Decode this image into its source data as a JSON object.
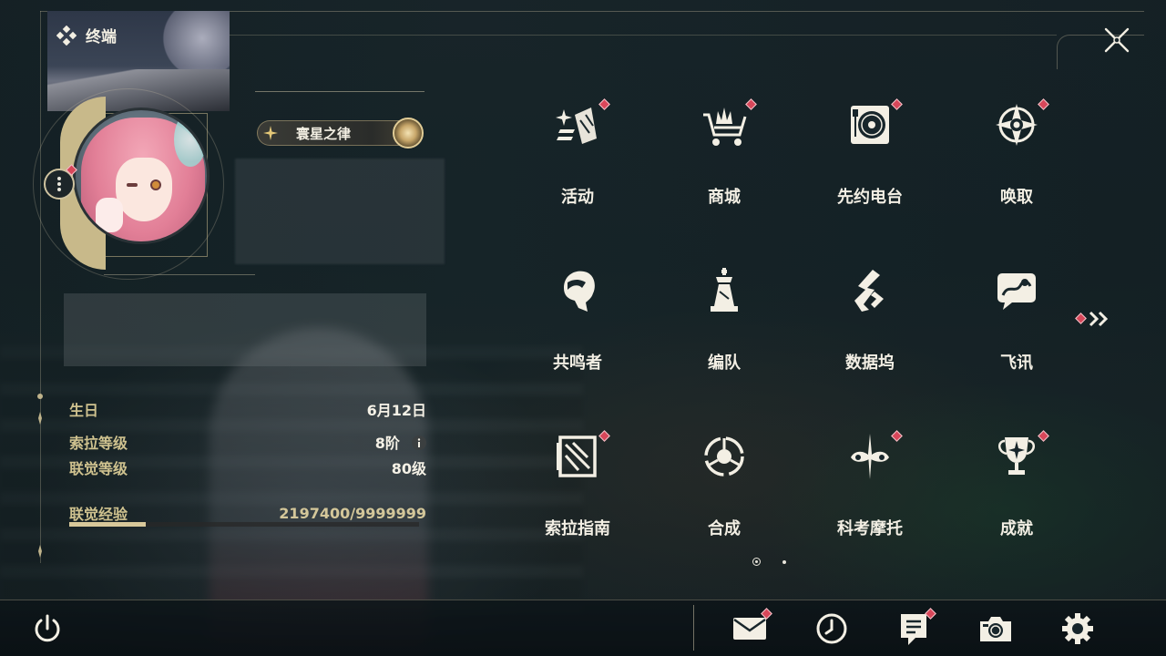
{
  "header": {
    "title": "终端",
    "logo_icon": "diamond-cluster-icon"
  },
  "profile": {
    "title_badge": "寰星之律",
    "stats": {
      "birthday_label": "生日",
      "birthday_value": "6月12日",
      "sola_level_label": "索拉等级",
      "sola_level_value": "8阶",
      "union_level_label": "联觉等级",
      "union_level_value": "80级",
      "union_exp_label": "联觉经验",
      "union_exp_value": "2197400/9999999",
      "union_exp_fraction": 0.22
    }
  },
  "menu": {
    "items": [
      {
        "label": "活动",
        "icon": "sparkle-events-icon",
        "badge": true
      },
      {
        "label": "商城",
        "icon": "shop-cart-icon",
        "badge": true
      },
      {
        "label": "先约电台",
        "icon": "radio-turntable-icon",
        "badge": true
      },
      {
        "label": "唤取",
        "icon": "convene-star-icon",
        "badge": true
      },
      {
        "label": "共鸣者",
        "icon": "resonator-head-icon",
        "badge": false
      },
      {
        "label": "编队",
        "icon": "chess-piece-icon",
        "badge": false
      },
      {
        "label": "数据坞",
        "icon": "data-dock-icon",
        "badge": false
      },
      {
        "label": "飞讯",
        "icon": "message-chat-icon",
        "badge": false
      },
      {
        "label": "索拉指南",
        "icon": "guidebook-icon",
        "badge": true
      },
      {
        "label": "合成",
        "icon": "synthesis-icon",
        "badge": false
      },
      {
        "label": "科考摩托",
        "icon": "motorbike-icon",
        "badge": true
      },
      {
        "label": "成就",
        "icon": "trophy-icon",
        "badge": true
      }
    ],
    "page_indicator": {
      "current": 1,
      "total": 2
    }
  },
  "bottom_bar": {
    "buttons": [
      {
        "name": "power-icon",
        "badge": false
      },
      {
        "name": "mail-icon",
        "badge": true
      },
      {
        "name": "clock-icon",
        "badge": false
      },
      {
        "name": "notice-icon",
        "badge": true
      },
      {
        "name": "camera-icon",
        "badge": false
      },
      {
        "name": "settings-gear-icon",
        "badge": false
      }
    ]
  },
  "colors": {
    "accent_gold": "#cfc28f",
    "badge_red": "#d8475a",
    "text_light": "#f3efe4"
  }
}
